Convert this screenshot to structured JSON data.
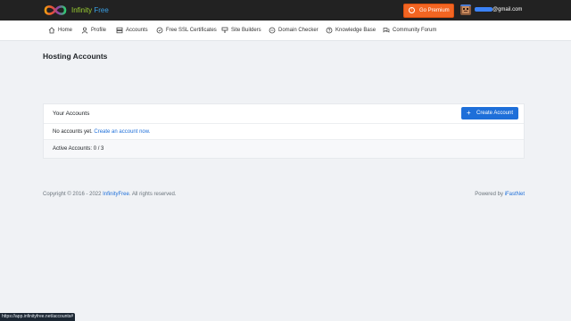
{
  "header": {
    "brand_part1": "Infinity",
    "brand_part2": "Free",
    "premium_label": "Go Premium",
    "email_suffix": "@gmail.com"
  },
  "nav": {
    "items": [
      {
        "label": "Home",
        "icon": "home-icon"
      },
      {
        "label": "Profile",
        "icon": "user-icon"
      },
      {
        "label": "Accounts",
        "icon": "server-icon"
      },
      {
        "label": "Free SSL Certificates",
        "icon": "shield-icon"
      },
      {
        "label": "Site Builders",
        "icon": "paint-icon"
      },
      {
        "label": "Domain Checker",
        "icon": "globe-icon"
      },
      {
        "label": "Knowledge Base",
        "icon": "help-icon"
      },
      {
        "label": "Community Forum",
        "icon": "chat-icon"
      }
    ]
  },
  "main": {
    "page_title": "Hosting Accounts",
    "card_title": "Your Accounts",
    "create_label": "Create Account",
    "empty_text": "No accounts yet.",
    "empty_link": "Create an account now.",
    "active_accounts": "Active Accounts: 0 / 3"
  },
  "footer": {
    "copyright_prefix": "Copyright © 2016 - 2022",
    "copyright_link": "InfinityFree",
    "copyright_suffix": ". All rights reserved.",
    "powered_prefix": "Powered by",
    "powered_link": "iFastNet"
  },
  "statusbar": {
    "url": "https://app.infinityfree.net/accounts#"
  },
  "colors": {
    "topbar": "#222222",
    "premium": "#f26522",
    "primary": "#1e6fd9",
    "brand_green": "#9acd32",
    "brand_blue": "#3aa0e6"
  }
}
